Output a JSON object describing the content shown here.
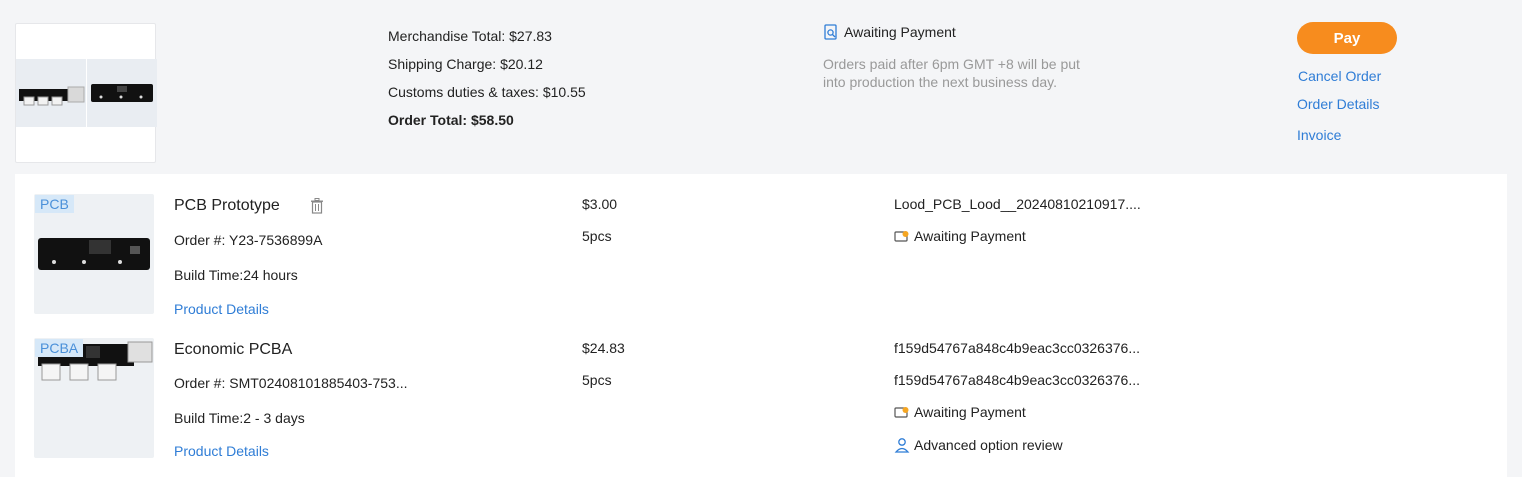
{
  "summary": {
    "merchandise_total": "Merchandise Total: $27.83",
    "shipping_charge": "Shipping Charge: $20.12",
    "customs": "Customs duties & taxes: $10.55",
    "order_total": "Order Total: $58.50",
    "status": "Awaiting Payment",
    "status_note": "Orders paid after 6pm GMT +8 will be put into production the next business day.",
    "icons": [
      "search-document-icon"
    ]
  },
  "actions": {
    "pay": "Pay",
    "cancel": "Cancel Order",
    "details": "Order Details",
    "invoice": "Invoice"
  },
  "items": [
    {
      "tag": "PCB",
      "title": "PCB Prototype",
      "order_no": "Order #: Y23-7536899A",
      "build_time": "Build Time:24 hours",
      "details_link": "Product Details",
      "price": "$3.00",
      "qty": "5pcs",
      "file": "Lood_PCB_Lood__20240810210917....",
      "status": "Awaiting Payment"
    },
    {
      "tag": "PCBA",
      "title": "Economic PCBA",
      "order_no": "Order #: SMT02408101885403-753...",
      "build_time": "Build Time:2 - 3 days",
      "details_link": "Product Details",
      "price": "$24.83",
      "qty": "5pcs",
      "file": "f159d54767a848c4b9eac3cc0326376...",
      "file2": "f159d54767a848c4b9eac3cc0326376...",
      "status": "Awaiting Payment",
      "review": "Advanced option review"
    }
  ],
  "colors": {
    "accent_orange": "#f78c1e",
    "link_blue": "#2f7dd6",
    "muted_gray": "#999999"
  }
}
